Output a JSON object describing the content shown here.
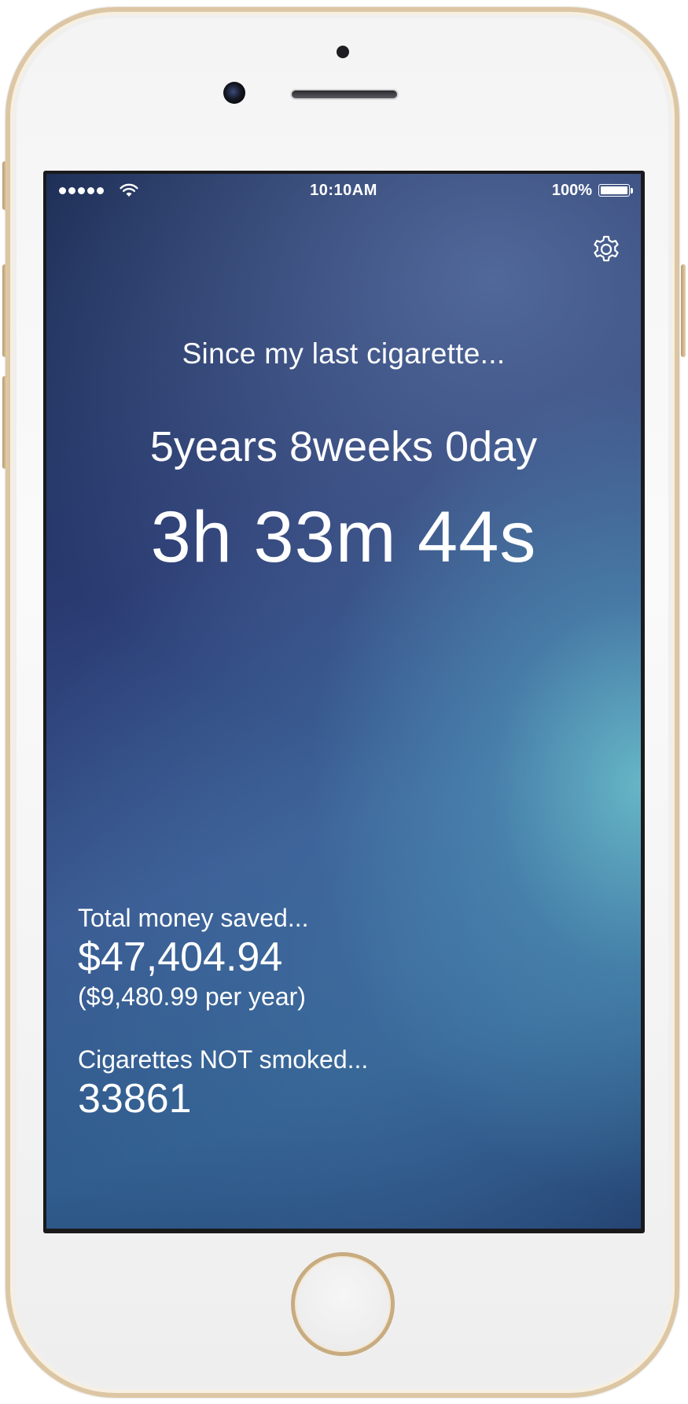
{
  "status_bar": {
    "time": "10:10AM",
    "battery_percent": "100%",
    "signal_bars": 5,
    "icons": [
      "signal-dots-icon",
      "wifi-icon",
      "battery-icon"
    ]
  },
  "header": {
    "settings_icon": "gear-icon"
  },
  "timer": {
    "since_label": "Since my last cigarette...",
    "duration_long": "5years 8weeks 0day",
    "duration_short": "3h 33m 44s"
  },
  "money": {
    "label": "Total money saved...",
    "value": "$47,404.94",
    "per_year": "($9,480.99 per year)"
  },
  "cigarettes": {
    "label": "Cigarettes NOT smoked...",
    "value": "33861"
  },
  "colors": {
    "frame_gold": "#dcc6a4",
    "screen_dark": "#15254a",
    "screen_teal": "#68bac8",
    "text": "#ffffff"
  }
}
